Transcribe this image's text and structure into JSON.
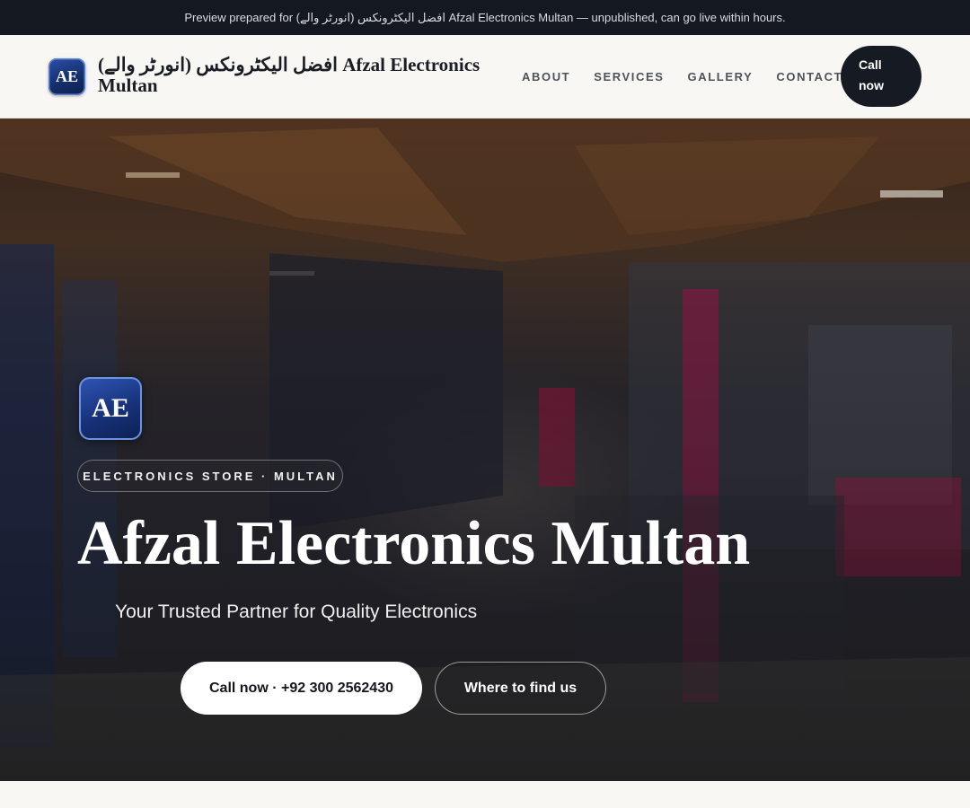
{
  "preview_bar": {
    "text": "Preview prepared for افضل الیکٹرونکس (انورٹر والے) Afzal Electronics Multan — unpublished, can go live within hours."
  },
  "header": {
    "logo_initials": "AE",
    "brand_name": "افضل الیکٹرونکس (انورٹر والے) Afzal Electronics Multan",
    "nav": [
      "ABOUT",
      "SERVICES",
      "GALLERY",
      "CONTACT"
    ],
    "call_button": "Call now"
  },
  "hero": {
    "badge_initials": "AE",
    "eyebrow": "ELECTRONICS STORE · MULTAN",
    "title": "Afzal Electronics Multan",
    "subtitle": "Your Trusted Partner for Quality Electronics",
    "primary_button": "Call now · +92 300 2562430",
    "secondary_button": "Where to find us"
  },
  "colors": {
    "preview_bar_bg": "#141820",
    "header_bg": "#f8f7f4",
    "dark_button": "#161a22",
    "badge_blue": "#17327a",
    "hero_text": "#ffffff"
  }
}
